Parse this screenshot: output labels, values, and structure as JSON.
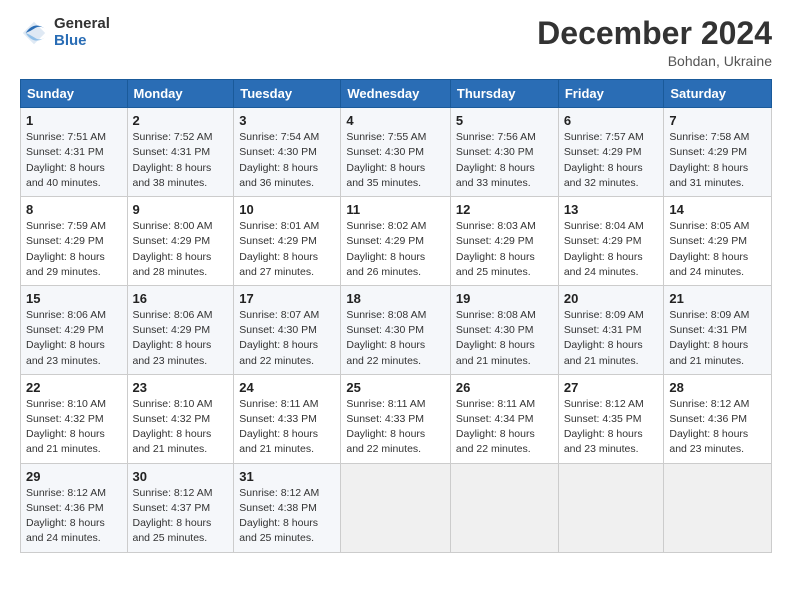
{
  "logo": {
    "general": "General",
    "blue": "Blue"
  },
  "title": {
    "month": "December 2024",
    "location": "Bohdan, Ukraine"
  },
  "calendar": {
    "headers": [
      "Sunday",
      "Monday",
      "Tuesday",
      "Wednesday",
      "Thursday",
      "Friday",
      "Saturday"
    ],
    "weeks": [
      [
        {
          "day": "1",
          "sunrise": "7:51 AM",
          "sunset": "4:31 PM",
          "daylight": "8 hours and 40 minutes."
        },
        {
          "day": "2",
          "sunrise": "7:52 AM",
          "sunset": "4:31 PM",
          "daylight": "8 hours and 38 minutes."
        },
        {
          "day": "3",
          "sunrise": "7:54 AM",
          "sunset": "4:30 PM",
          "daylight": "8 hours and 36 minutes."
        },
        {
          "day": "4",
          "sunrise": "7:55 AM",
          "sunset": "4:30 PM",
          "daylight": "8 hours and 35 minutes."
        },
        {
          "day": "5",
          "sunrise": "7:56 AM",
          "sunset": "4:30 PM",
          "daylight": "8 hours and 33 minutes."
        },
        {
          "day": "6",
          "sunrise": "7:57 AM",
          "sunset": "4:29 PM",
          "daylight": "8 hours and 32 minutes."
        },
        {
          "day": "7",
          "sunrise": "7:58 AM",
          "sunset": "4:29 PM",
          "daylight": "8 hours and 31 minutes."
        }
      ],
      [
        {
          "day": "8",
          "sunrise": "7:59 AM",
          "sunset": "4:29 PM",
          "daylight": "8 hours and 29 minutes."
        },
        {
          "day": "9",
          "sunrise": "8:00 AM",
          "sunset": "4:29 PM",
          "daylight": "8 hours and 28 minutes."
        },
        {
          "day": "10",
          "sunrise": "8:01 AM",
          "sunset": "4:29 PM",
          "daylight": "8 hours and 27 minutes."
        },
        {
          "day": "11",
          "sunrise": "8:02 AM",
          "sunset": "4:29 PM",
          "daylight": "8 hours and 26 minutes."
        },
        {
          "day": "12",
          "sunrise": "8:03 AM",
          "sunset": "4:29 PM",
          "daylight": "8 hours and 25 minutes."
        },
        {
          "day": "13",
          "sunrise": "8:04 AM",
          "sunset": "4:29 PM",
          "daylight": "8 hours and 24 minutes."
        },
        {
          "day": "14",
          "sunrise": "8:05 AM",
          "sunset": "4:29 PM",
          "daylight": "8 hours and 24 minutes."
        }
      ],
      [
        {
          "day": "15",
          "sunrise": "8:06 AM",
          "sunset": "4:29 PM",
          "daylight": "8 hours and 23 minutes."
        },
        {
          "day": "16",
          "sunrise": "8:06 AM",
          "sunset": "4:29 PM",
          "daylight": "8 hours and 23 minutes."
        },
        {
          "day": "17",
          "sunrise": "8:07 AM",
          "sunset": "4:30 PM",
          "daylight": "8 hours and 22 minutes."
        },
        {
          "day": "18",
          "sunrise": "8:08 AM",
          "sunset": "4:30 PM",
          "daylight": "8 hours and 22 minutes."
        },
        {
          "day": "19",
          "sunrise": "8:08 AM",
          "sunset": "4:30 PM",
          "daylight": "8 hours and 21 minutes."
        },
        {
          "day": "20",
          "sunrise": "8:09 AM",
          "sunset": "4:31 PM",
          "daylight": "8 hours and 21 minutes."
        },
        {
          "day": "21",
          "sunrise": "8:09 AM",
          "sunset": "4:31 PM",
          "daylight": "8 hours and 21 minutes."
        }
      ],
      [
        {
          "day": "22",
          "sunrise": "8:10 AM",
          "sunset": "4:32 PM",
          "daylight": "8 hours and 21 minutes."
        },
        {
          "day": "23",
          "sunrise": "8:10 AM",
          "sunset": "4:32 PM",
          "daylight": "8 hours and 21 minutes."
        },
        {
          "day": "24",
          "sunrise": "8:11 AM",
          "sunset": "4:33 PM",
          "daylight": "8 hours and 21 minutes."
        },
        {
          "day": "25",
          "sunrise": "8:11 AM",
          "sunset": "4:33 PM",
          "daylight": "8 hours and 22 minutes."
        },
        {
          "day": "26",
          "sunrise": "8:11 AM",
          "sunset": "4:34 PM",
          "daylight": "8 hours and 22 minutes."
        },
        {
          "day": "27",
          "sunrise": "8:12 AM",
          "sunset": "4:35 PM",
          "daylight": "8 hours and 23 minutes."
        },
        {
          "day": "28",
          "sunrise": "8:12 AM",
          "sunset": "4:36 PM",
          "daylight": "8 hours and 23 minutes."
        }
      ],
      [
        {
          "day": "29",
          "sunrise": "8:12 AM",
          "sunset": "4:36 PM",
          "daylight": "8 hours and 24 minutes."
        },
        {
          "day": "30",
          "sunrise": "8:12 AM",
          "sunset": "4:37 PM",
          "daylight": "8 hours and 25 minutes."
        },
        {
          "day": "31",
          "sunrise": "8:12 AM",
          "sunset": "4:38 PM",
          "daylight": "8 hours and 25 minutes."
        },
        null,
        null,
        null,
        null
      ]
    ]
  }
}
